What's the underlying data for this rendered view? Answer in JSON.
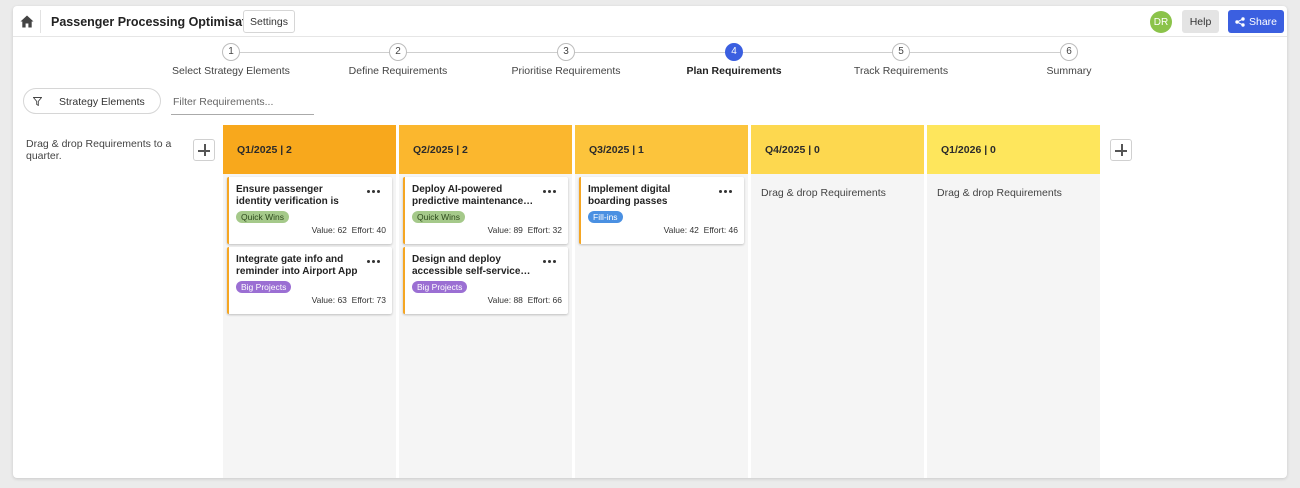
{
  "app": {
    "title": "Passenger Processing Optimisation",
    "settings_label": "Settings",
    "avatar_initials": "DR",
    "help_label": "Help",
    "share_label": "Share",
    "accent_color": "#3b5fe0"
  },
  "steps": [
    {
      "number": "1",
      "label": "Select Strategy Elements",
      "active": false
    },
    {
      "number": "2",
      "label": "Define Requirements",
      "active": false
    },
    {
      "number": "3",
      "label": "Prioritise Requirements",
      "active": false
    },
    {
      "number": "4",
      "label": "Plan Requirements",
      "active": true
    },
    {
      "number": "5",
      "label": "Track Requirements",
      "active": false
    },
    {
      "number": "6",
      "label": "Summary",
      "active": false
    }
  ],
  "filters": {
    "strategy_label": "Strategy Elements",
    "search_placeholder": "Filter Requirements..."
  },
  "board": {
    "drag_hint": "Drag & drop Requirements to a quarter.",
    "empty_text": "Drag & drop Requirements",
    "columns": [
      {
        "header": "Q1/2025 | 2",
        "color": "#f8a81c",
        "cards": [
          {
            "title": "Ensure passenger identity verification is seamless",
            "tag": "Quick Wins",
            "tag_color": "#a5c98a",
            "value_text": "Value: 62",
            "effort_text": "Effort: 40"
          },
          {
            "title": "Integrate gate info and reminder into Airport App",
            "tag": "Big Projects",
            "tag_color": "#9b6fd3",
            "value_text": "Value: 63",
            "effort_text": "Effort: 73"
          }
        ]
      },
      {
        "header": "Q2/2025 | 2",
        "color": "#fbb72e",
        "cards": [
          {
            "title": "Deploy AI-powered predictive maintenance…",
            "tag": "Quick Wins",
            "tag_color": "#a5c98a",
            "value_text": "Value: 89",
            "effort_text": "Effort: 32"
          },
          {
            "title": "Design and deploy accessible self-service…",
            "tag": "Big Projects",
            "tag_color": "#9b6fd3",
            "value_text": "Value: 88",
            "effort_text": "Effort: 66"
          }
        ]
      },
      {
        "header": "Q3/2025 | 1",
        "color": "#fcc43c",
        "cards": [
          {
            "title": "Implement digital boarding passes integration",
            "tag": "Fill-ins",
            "tag_color": "#4a90e2",
            "value_text": "Value: 42",
            "effort_text": "Effort: 46"
          }
        ]
      },
      {
        "header": "Q4/2025 | 0",
        "color": "#fdd84f",
        "cards": []
      },
      {
        "header": "Q1/2026 | 0",
        "color": "#fee65c",
        "cards": []
      }
    ]
  }
}
